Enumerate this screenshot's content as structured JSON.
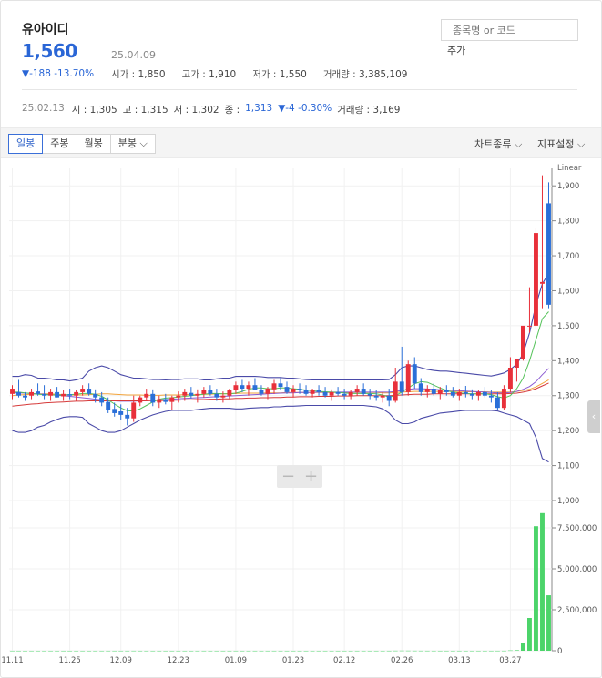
{
  "header": {
    "stock_name": "유아이디",
    "price": "1,560",
    "date": "25.04.09",
    "change": "▼-188 -13.70%",
    "open_label": "시가 : ",
    "open": "1,850",
    "high_label": "고가 : ",
    "high": "1,910",
    "low_label": "저가 : ",
    "low": "1,550",
    "volume_label": "거래량 : ",
    "volume": "3,385,109"
  },
  "search": {
    "placeholder": "종목명 or 코드",
    "add_label": "추가"
  },
  "cursor": {
    "date": "25.02.13",
    "open": "시 : 1,305",
    "high": "고 : 1,315",
    "low": "저 : 1,302",
    "close_label": "종 :",
    "close": "1,313",
    "change": "▼-4 -0.30%",
    "volume": "거래량 : 3,169"
  },
  "toolbar": {
    "tabs": [
      "일봉",
      "주봉",
      "월봉",
      "분봉"
    ],
    "chart_type": "차트종류",
    "indicator": "지표설정"
  },
  "colors": {
    "up": "#e8303a",
    "down": "#2a6fd8",
    "volume": "#4cd46a",
    "accent": "#2a66d6"
  },
  "icons": {
    "zoom_out": "−",
    "zoom_in": "+",
    "side_handle": "‹",
    "dropdown": "chevron-down-icon"
  },
  "chart_data": {
    "type": "candlestick",
    "scale_label": "Linear",
    "price_axis": {
      "ticks": [
        "1,900",
        "1,800",
        "1,700",
        "1,600",
        "1,500",
        "1,400",
        "1,300",
        "1,200",
        "1,100",
        "1,000"
      ],
      "range": [
        1000,
        1950
      ]
    },
    "volume_axis": {
      "ticks": [
        "7,500,000",
        "5,000,000",
        "2,500,000",
        "0"
      ],
      "range": [
        0,
        9000000
      ]
    },
    "x_tick_labels": [
      "11.11",
      "11.25",
      "12.09",
      "12.23",
      "01.09",
      "01.23",
      "02.12",
      "02.26",
      "03.13",
      "03.27"
    ],
    "candles": [
      [
        1305,
        1330,
        1290,
        1320,
        2000
      ],
      [
        1310,
        1345,
        1295,
        1300,
        1500
      ],
      [
        1300,
        1310,
        1285,
        1295,
        1200
      ],
      [
        1300,
        1320,
        1290,
        1310,
        1800
      ],
      [
        1312,
        1335,
        1300,
        1305,
        1500
      ],
      [
        1305,
        1330,
        1290,
        1300,
        1400
      ],
      [
        1300,
        1320,
        1285,
        1310,
        1600
      ],
      [
        1310,
        1325,
        1295,
        1295,
        1300
      ],
      [
        1298,
        1315,
        1285,
        1305,
        1700
      ],
      [
        1304,
        1320,
        1290,
        1300,
        1200
      ],
      [
        1300,
        1315,
        1285,
        1310,
        1500
      ],
      [
        1310,
        1330,
        1300,
        1320,
        1800
      ],
      [
        1320,
        1335,
        1300,
        1305,
        1400
      ],
      [
        1305,
        1318,
        1280,
        1295,
        1600
      ],
      [
        1295,
        1310,
        1270,
        1280,
        2100
      ],
      [
        1282,
        1295,
        1250,
        1260,
        2600
      ],
      [
        1262,
        1280,
        1240,
        1250,
        2300
      ],
      [
        1255,
        1275,
        1230,
        1245,
        1800
      ],
      [
        1245,
        1265,
        1215,
        1235,
        2400
      ],
      [
        1235,
        1300,
        1225,
        1280,
        3200
      ],
      [
        1280,
        1300,
        1270,
        1295,
        1900
      ],
      [
        1295,
        1320,
        1285,
        1305,
        1600
      ],
      [
        1305,
        1318,
        1270,
        1280,
        1500
      ],
      [
        1280,
        1300,
        1265,
        1290,
        1700
      ],
      [
        1290,
        1305,
        1275,
        1282,
        1400
      ],
      [
        1282,
        1300,
        1260,
        1295,
        1600
      ],
      [
        1295,
        1312,
        1280,
        1300,
        1200
      ],
      [
        1300,
        1320,
        1285,
        1310,
        1500
      ],
      [
        1308,
        1325,
        1292,
        1300,
        1300
      ],
      [
        1300,
        1318,
        1280,
        1305,
        1600
      ],
      [
        1305,
        1325,
        1295,
        1315,
        1800
      ],
      [
        1315,
        1330,
        1300,
        1305,
        1500
      ],
      [
        1305,
        1320,
        1285,
        1295,
        1400
      ],
      [
        1295,
        1312,
        1280,
        1300,
        1600
      ],
      [
        1300,
        1320,
        1290,
        1315,
        1700
      ],
      [
        1315,
        1340,
        1305,
        1330,
        2200
      ],
      [
        1330,
        1345,
        1310,
        1320,
        1900
      ],
      [
        1320,
        1340,
        1300,
        1330,
        1700
      ],
      [
        1330,
        1350,
        1315,
        1315,
        2000
      ],
      [
        1315,
        1330,
        1300,
        1305,
        1500
      ],
      [
        1305,
        1325,
        1290,
        1320,
        1600
      ],
      [
        1318,
        1345,
        1305,
        1335,
        2100
      ],
      [
        1335,
        1350,
        1315,
        1325,
        1800
      ],
      [
        1325,
        1340,
        1305,
        1310,
        1500
      ],
      [
        1310,
        1330,
        1295,
        1320,
        1600
      ],
      [
        1320,
        1335,
        1305,
        1315,
        1400
      ],
      [
        1315,
        1330,
        1300,
        1305,
        1300
      ],
      [
        1305,
        1320,
        1295,
        1315,
        1500
      ],
      [
        1315,
        1330,
        1300,
        1310,
        1200
      ],
      [
        1310,
        1325,
        1295,
        1300,
        1400
      ],
      [
        1300,
        1318,
        1285,
        1310,
        1600
      ],
      [
        1310,
        1325,
        1300,
        1305,
        1300
      ],
      [
        1305,
        1320,
        1290,
        1300,
        1500
      ],
      [
        1300,
        1316,
        1290,
        1310,
        1400
      ],
      [
        1310,
        1330,
        1300,
        1320,
        1700
      ],
      [
        1320,
        1335,
        1300,
        1305,
        1600
      ],
      [
        1305,
        1320,
        1290,
        1300,
        1300
      ],
      [
        1300,
        1315,
        1285,
        1295,
        1500
      ],
      [
        1295,
        1310,
        1280,
        1300,
        1400
      ],
      [
        1300,
        1320,
        1270,
        1285,
        2500
      ],
      [
        1285,
        1380,
        1280,
        1340,
        6500
      ],
      [
        1340,
        1440,
        1300,
        1310,
        9500
      ],
      [
        1310,
        1400,
        1300,
        1390,
        8200
      ],
      [
        1390,
        1410,
        1320,
        1335,
        5200
      ],
      [
        1335,
        1350,
        1300,
        1310,
        3800
      ],
      [
        1310,
        1330,
        1295,
        1320,
        2600
      ],
      [
        1320,
        1335,
        1300,
        1305,
        2200
      ],
      [
        1305,
        1325,
        1290,
        1315,
        2000
      ],
      [
        1315,
        1330,
        1300,
        1310,
        1900
      ],
      [
        1310,
        1325,
        1295,
        1300,
        1700
      ],
      [
        1300,
        1320,
        1285,
        1310,
        1800
      ],
      [
        1310,
        1328,
        1295,
        1305,
        1500
      ],
      [
        1305,
        1318,
        1290,
        1300,
        1600
      ],
      [
        1300,
        1315,
        1285,
        1310,
        1400
      ],
      [
        1310,
        1325,
        1295,
        1300,
        1500
      ],
      [
        1300,
        1315,
        1280,
        1295,
        1700
      ],
      [
        1295,
        1310,
        1260,
        1265,
        2300
      ],
      [
        1265,
        1330,
        1260,
        1320,
        3400
      ],
      [
        1320,
        1410,
        1310,
        1380,
        22000
      ],
      [
        1380,
        1400,
        1340,
        1405,
        35000
      ],
      [
        1405,
        1420,
        1400,
        1500,
        500000
      ],
      [
        1500,
        1610,
        1480,
        1500,
        2000000
      ],
      [
        1500,
        1780,
        1490,
        1765,
        7600000
      ],
      [
        1620,
        1930,
        1550,
        1625,
        8400000
      ],
      [
        1850,
        1910,
        1550,
        1560,
        3385109
      ]
    ],
    "bollinger": {
      "upper": [
        1355,
        1355,
        1360,
        1358,
        1350,
        1350,
        1348,
        1345,
        1345,
        1342,
        1345,
        1350,
        1370,
        1380,
        1385,
        1380,
        1370,
        1360,
        1355,
        1350,
        1350,
        1348,
        1346,
        1346,
        1345,
        1346,
        1346,
        1348,
        1348,
        1348,
        1345,
        1345,
        1348,
        1350,
        1350,
        1355,
        1355,
        1355,
        1355,
        1354,
        1352,
        1352,
        1352,
        1350,
        1350,
        1348,
        1346,
        1345,
        1345,
        1345,
        1345,
        1345,
        1345,
        1345,
        1345,
        1345,
        1345,
        1345,
        1345,
        1346,
        1360,
        1380,
        1385,
        1385,
        1380,
        1375,
        1372,
        1370,
        1370,
        1368,
        1366,
        1364,
        1362,
        1360,
        1358,
        1356,
        1360,
        1365,
        1375,
        1390,
        1420,
        1480,
        1560,
        1620,
        1650
      ],
      "lower": [
        1200,
        1195,
        1195,
        1200,
        1210,
        1215,
        1225,
        1232,
        1238,
        1240,
        1240,
        1238,
        1220,
        1210,
        1200,
        1195,
        1195,
        1200,
        1210,
        1220,
        1230,
        1238,
        1245,
        1250,
        1255,
        1258,
        1258,
        1258,
        1258,
        1260,
        1262,
        1264,
        1264,
        1264,
        1264,
        1262,
        1262,
        1264,
        1265,
        1266,
        1266,
        1268,
        1268,
        1270,
        1270,
        1271,
        1272,
        1272,
        1272,
        1272,
        1272,
        1272,
        1272,
        1272,
        1272,
        1272,
        1270,
        1268,
        1262,
        1250,
        1230,
        1220,
        1220,
        1225,
        1235,
        1240,
        1245,
        1250,
        1252,
        1254,
        1256,
        1258,
        1258,
        1258,
        1258,
        1258,
        1256,
        1250,
        1245,
        1240,
        1230,
        1220,
        1180,
        1120,
        1110
      ]
    },
    "moving_averages": [
      {
        "color": "#f2a33a",
        "values": [
          1300,
          1302,
          1303,
          1304,
          1305,
          1305,
          1305,
          1304,
          1303,
          1302,
          1302,
          1302,
          1303,
          1304,
          1305,
          1305,
          1304,
          1303,
          1302,
          1302,
          1302,
          1301,
          1301,
          1301,
          1302,
          1302,
          1302,
          1303,
          1303,
          1303,
          1304,
          1304,
          1305,
          1305,
          1306,
          1306,
          1307,
          1307,
          1307,
          1307,
          1308,
          1308,
          1308,
          1309,
          1309,
          1309,
          1309,
          1309,
          1309,
          1309,
          1309,
          1309,
          1309,
          1309,
          1309,
          1309,
          1309,
          1309,
          1308,
          1308,
          1309,
          1310,
          1311,
          1312,
          1312,
          1312,
          1312,
          1312,
          1312,
          1312,
          1312,
          1311,
          1311,
          1311,
          1311,
          1310,
          1310,
          1310,
          1310,
          1312,
          1315,
          1318,
          1325,
          1335,
          1345
        ]
      },
      {
        "color": "#8b5bd1",
        "values": [
          1308,
          1308,
          1307,
          1306,
          1305,
          1304,
          1303,
          1301,
          1300,
          1298,
          1296,
          1294,
          1292,
          1290,
          1288,
          1286,
          1285,
          1284,
          1284,
          1284,
          1285,
          1286,
          1287,
          1288,
          1289,
          1290,
          1291,
          1292,
          1293,
          1294,
          1295,
          1296,
          1297,
          1298,
          1299,
          1300,
          1301,
          1302,
          1303,
          1304,
          1305,
          1306,
          1307,
          1308,
          1308,
          1309,
          1309,
          1309,
          1310,
          1310,
          1310,
          1310,
          1310,
          1310,
          1310,
          1310,
          1310,
          1310,
          1310,
          1310,
          1312,
          1315,
          1318,
          1320,
          1320,
          1319,
          1318,
          1317,
          1316,
          1315,
          1314,
          1313,
          1312,
          1311,
          1310,
          1309,
          1308,
          1308,
          1309,
          1312,
          1318,
          1326,
          1340,
          1360,
          1378
        ]
      },
      {
        "color": "#d63a3a",
        "values": [
          1270,
          1272,
          1274,
          1276,
          1277,
          1279,
          1280,
          1281,
          1282,
          1283,
          1284,
          1284,
          1285,
          1285,
          1285,
          1285,
          1285,
          1285,
          1285,
          1285,
          1285,
          1285,
          1286,
          1286,
          1286,
          1287,
          1287,
          1288,
          1288,
          1289,
          1289,
          1290,
          1290,
          1291,
          1291,
          1292,
          1292,
          1293,
          1293,
          1294,
          1294,
          1295,
          1295,
          1296,
          1296,
          1297,
          1297,
          1297,
          1298,
          1298,
          1298,
          1299,
          1299,
          1299,
          1300,
          1300,
          1300,
          1300,
          1300,
          1300,
          1301,
          1302,
          1303,
          1304,
          1304,
          1304,
          1305,
          1305,
          1305,
          1305,
          1305,
          1305,
          1305,
          1305,
          1305,
          1305,
          1305,
          1305,
          1306,
          1307,
          1310,
          1314,
          1320,
          1328,
          1336
        ]
      },
      {
        "color": "#55c25a",
        "values": [
          1310,
          1310,
          1308,
          1306,
          1304,
          1303,
          1302,
          1302,
          1302,
          1303,
          1304,
          1306,
          1306,
          1304,
          1298,
          1288,
          1276,
          1265,
          1257,
          1256,
          1262,
          1272,
          1282,
          1290,
          1293,
          1294,
          1296,
          1298,
          1300,
          1302,
          1304,
          1306,
          1306,
          1305,
          1305,
          1307,
          1312,
          1318,
          1322,
          1322,
          1320,
          1320,
          1322,
          1322,
          1320,
          1318,
          1316,
          1314,
          1312,
          1311,
          1310,
          1309,
          1308,
          1306,
          1306,
          1306,
          1306,
          1305,
          1302,
          1296,
          1300,
          1310,
          1322,
          1334,
          1340,
          1338,
          1330,
          1322,
          1315,
          1310,
          1308,
          1306,
          1305,
          1305,
          1305,
          1303,
          1297,
          1293,
          1300,
          1320,
          1350,
          1400,
          1460,
          1520,
          1540
        ]
      }
    ]
  }
}
